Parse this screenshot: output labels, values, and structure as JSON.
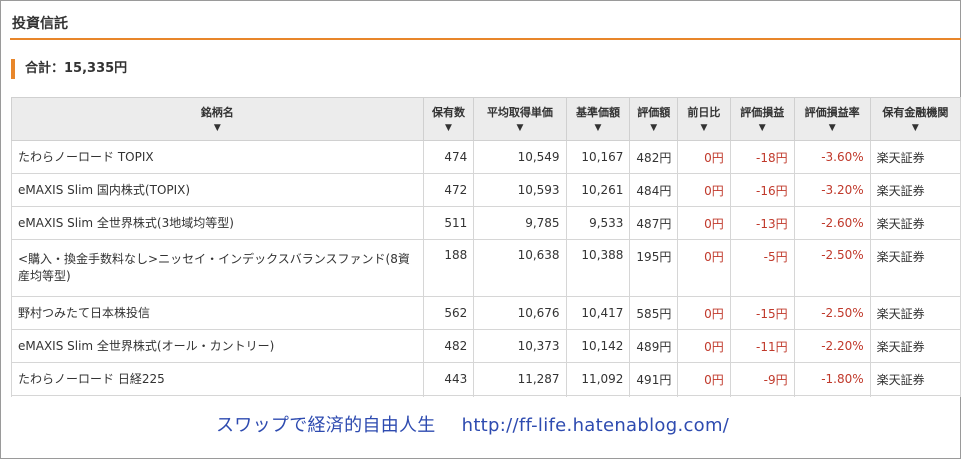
{
  "section": {
    "title": "投資信託",
    "total_label": "合計：15,335円"
  },
  "table": {
    "headers": {
      "name": "銘柄名",
      "units": "保有数",
      "avg_price": "平均取得単価",
      "base_price": "基準価額",
      "value": "評価額",
      "day_change": "前日比",
      "gain": "評価損益",
      "gain_rate": "評価損益率",
      "institution": "保有金融機関",
      "sort_arrow": "▼"
    },
    "rows": [
      {
        "name": "たわらノーロード TOPIX",
        "units": "474",
        "avg_price": "10,549",
        "base_price": "10,167",
        "value": "482円",
        "day_change": "0円",
        "gain": "-18円",
        "gain_rate": "-3.60%",
        "institution": "楽天証券"
      },
      {
        "name": "eMAXIS Slim 国内株式(TOPIX)",
        "units": "472",
        "avg_price": "10,593",
        "base_price": "10,261",
        "value": "484円",
        "day_change": "0円",
        "gain": "-16円",
        "gain_rate": "-3.20%",
        "institution": "楽天証券"
      },
      {
        "name": "eMAXIS Slim 全世界株式(3地域均等型)",
        "units": "511",
        "avg_price": "9,785",
        "base_price": "9,533",
        "value": "487円",
        "day_change": "0円",
        "gain": "-13円",
        "gain_rate": "-2.60%",
        "institution": "楽天証券"
      },
      {
        "name": "<購入・換金手数料なし>ニッセイ・インデックスバランスファンド(8資産均等型)",
        "units": "188",
        "avg_price": "10,638",
        "base_price": "10,388",
        "value": "195円",
        "day_change": "0円",
        "gain": "-5円",
        "gain_rate": "-2.50%",
        "institution": "楽天証券"
      },
      {
        "name": "野村つみたて日本株投信",
        "units": "562",
        "avg_price": "10,676",
        "base_price": "10,417",
        "value": "585円",
        "day_change": "0円",
        "gain": "-15円",
        "gain_rate": "-2.50%",
        "institution": "楽天証券"
      },
      {
        "name": "eMAXIS Slim 全世界株式(オール・カントリー)",
        "units": "482",
        "avg_price": "10,373",
        "base_price": "10,142",
        "value": "489円",
        "day_change": "0円",
        "gain": "-11円",
        "gain_rate": "-2.20%",
        "institution": "楽天証券"
      },
      {
        "name": "たわらノーロード 日経225",
        "units": "443",
        "avg_price": "11,287",
        "base_price": "11,092",
        "value": "491円",
        "day_change": "0円",
        "gain": "-9円",
        "gain_rate": "-1.80%",
        "institution": "楽天証券"
      }
    ]
  },
  "watermark": {
    "text": "スワップで経済的自由人生",
    "url": "http://ff-life.hatenablog.com/"
  },
  "colors": {
    "accent": "#e8862a",
    "negative": "#c0392b",
    "watermark": "#2e4bb0"
  }
}
